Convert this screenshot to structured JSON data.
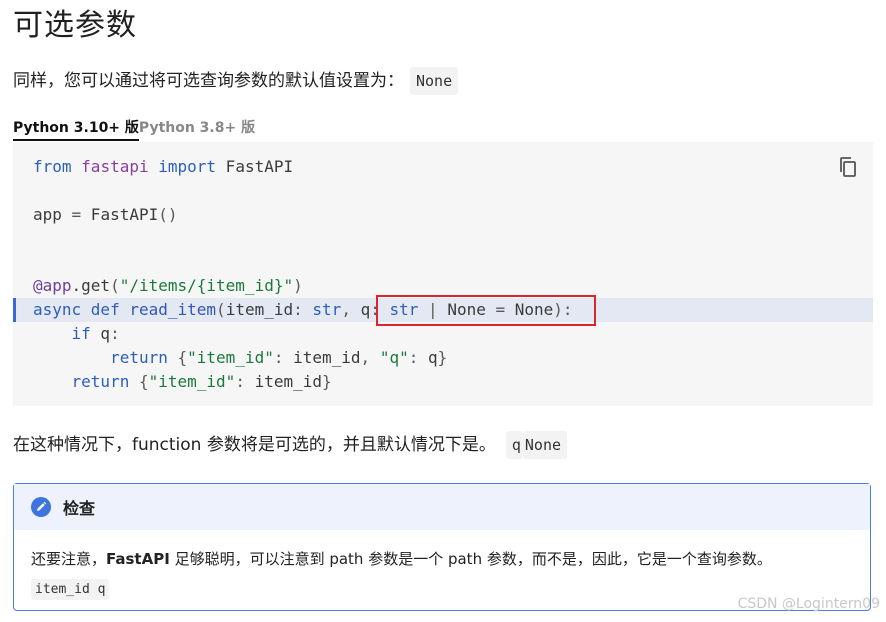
{
  "heading": "可选参数",
  "intro": {
    "text": "同样，您可以通过将可选查询参数的默认值设置为：",
    "code": "None"
  },
  "tabs": [
    {
      "label": "Python 3.10+ 版",
      "active": true
    },
    {
      "label": "Python 3.8+ 版",
      "active": false
    }
  ],
  "code": {
    "copy_icon": "copy-icon"
  },
  "explanation": {
    "text": "在这种情况下，function 参数将是可选的，并且默认情况下是。",
    "code1": "q",
    "code2": "None"
  },
  "admonition": {
    "icon": "pencil-icon",
    "title": "检查",
    "text_before": "还要注意，",
    "text_bold": "FastAPI",
    "text_after": " 足够聪明，可以注意到 path 参数是一个 path 参数，而不是，因此，它是一个查询参数。",
    "code": "item_id q",
    "accent_color": "#3d74dd"
  },
  "watermark": "CSDN @Logintern09"
}
